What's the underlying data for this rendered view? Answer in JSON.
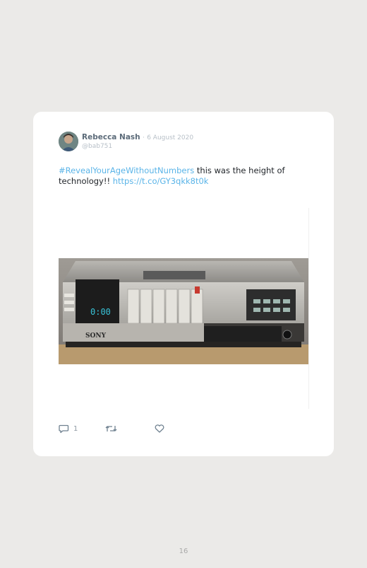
{
  "tweet": {
    "author_name": "Rebecca Nash",
    "separator": "·",
    "date": "6 August 2020",
    "handle": "@bab751",
    "hashtag": "#RevealYourAgeWithoutNumbers",
    "body_text": " this was the height of technology!! ",
    "link": "https://t.co/GY3qkk8t0k",
    "reply_count": "1"
  },
  "vcr_display": {
    "brand": "SONY",
    "clock": "0:00"
  },
  "page": {
    "number": "16"
  },
  "icons": [
    "avatar",
    "reply-icon",
    "retweet-icon",
    "like-icon"
  ]
}
